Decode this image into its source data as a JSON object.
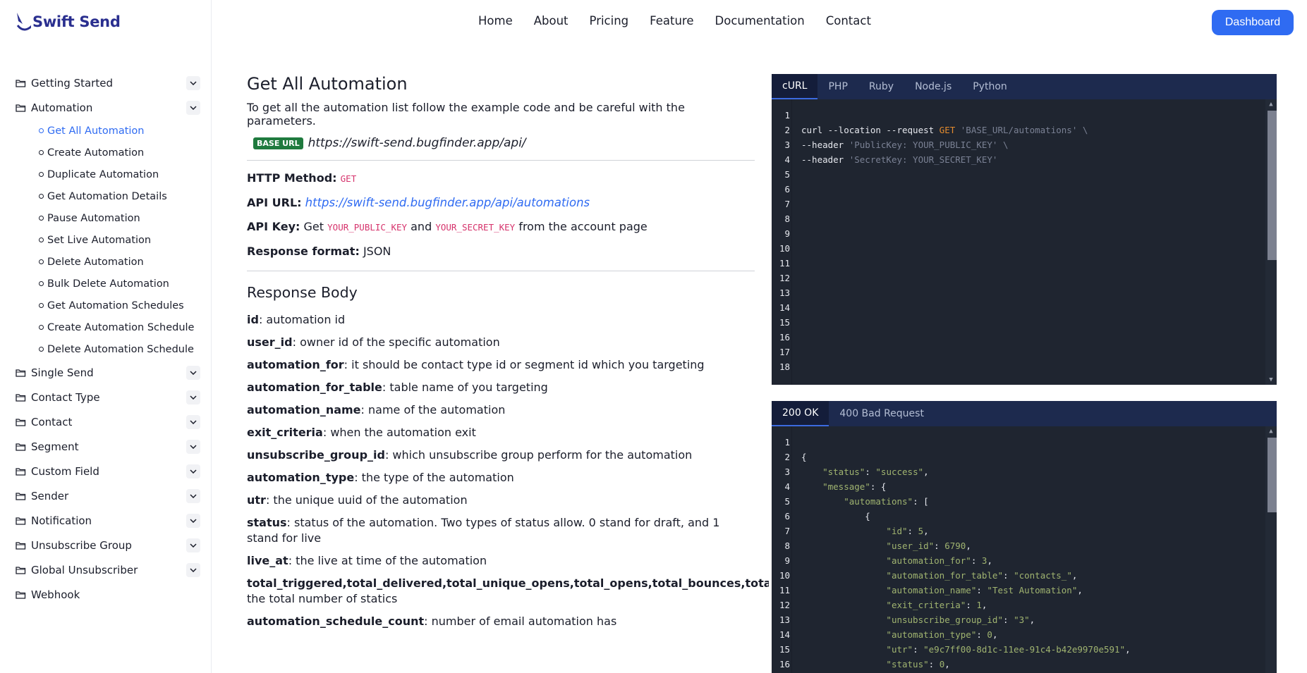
{
  "brand": {
    "name": "Swift Send"
  },
  "topnav": {
    "links": [
      "Home",
      "About",
      "Pricing",
      "Feature",
      "Documentation",
      "Contact"
    ],
    "dashboard": "Dashboard"
  },
  "sidebar": {
    "sections": [
      {
        "label": "Getting Started",
        "expandable": true
      },
      {
        "label": "Automation",
        "expandable": true,
        "expanded": true,
        "items": [
          {
            "label": "Get All Automation",
            "active": true
          },
          {
            "label": "Create Automation"
          },
          {
            "label": "Duplicate Automation"
          },
          {
            "label": "Get Automation Details"
          },
          {
            "label": "Pause Automation"
          },
          {
            "label": "Set Live Automation"
          },
          {
            "label": "Delete Automation"
          },
          {
            "label": "Bulk Delete Automation"
          },
          {
            "label": "Get Automation Schedules"
          },
          {
            "label": "Create Automation Schedule"
          },
          {
            "label": "Delete Automation Schedule"
          }
        ]
      },
      {
        "label": "Single Send",
        "expandable": true
      },
      {
        "label": "Contact Type",
        "expandable": true
      },
      {
        "label": "Contact",
        "expandable": true
      },
      {
        "label": "Segment",
        "expandable": true
      },
      {
        "label": "Custom Field",
        "expandable": true
      },
      {
        "label": "Sender",
        "expandable": true
      },
      {
        "label": "Notification",
        "expandable": true
      },
      {
        "label": "Unsubscribe Group",
        "expandable": true
      },
      {
        "label": "Global Unsubscriber",
        "expandable": true
      },
      {
        "label": "Webhook",
        "expandable": false
      }
    ]
  },
  "main": {
    "title": "Get All Automation",
    "intro": "To get all the automation list follow the example code and be careful with the parameters.",
    "base_badge": "BASE URL",
    "base_url": "https://swift-send.bugfinder.app/api/",
    "http_method_label": "HTTP Method:",
    "http_method": "GET",
    "api_url_label": "API URL:",
    "api_url": "https://swift-send.bugfinder.app/api/automations",
    "api_key_label": "API Key:",
    "api_key_get": "Get",
    "public_key": "YOUR_PUBLIC_KEY",
    "api_key_and": "and",
    "secret_key": "YOUR_SECRET_KEY",
    "api_key_tail": "from the account page",
    "response_format_label": "Response format:",
    "response_format": "JSON",
    "response_title": "Response Body",
    "fields": [
      {
        "name": "id",
        "desc": ": automation id"
      },
      {
        "name": "user_id",
        "desc": ": owner id of the specific automation"
      },
      {
        "name": "automation_for",
        "desc": ": it should be contact type id or segment id which you targeting"
      },
      {
        "name": "automation_for_table",
        "desc": ": table name of you targeting"
      },
      {
        "name": "automation_name",
        "desc": ": name of the automation"
      },
      {
        "name": "exit_criteria",
        "desc": ": when the automation exit"
      },
      {
        "name": "unsubscribe_group_id",
        "desc": ": which unsubscribe group perform for the automation"
      },
      {
        "name": "automation_type",
        "desc": ": the type of the automation"
      },
      {
        "name": "utr",
        "desc": ": the unique uuid of the automation"
      },
      {
        "name": "status",
        "desc": ": status of the automation. Two types of status allow. 0 stand for draft, and 1 stand for live"
      },
      {
        "name": "live_at",
        "desc": ": the live at time of the automation"
      },
      {
        "name": "total_triggered,total_delivered,total_unique_opens,total_opens,total_bounces,total_unsubscrib",
        "desc": "",
        "desc_line2": "the total number of statics"
      },
      {
        "name": "automation_schedule_count",
        "desc": ": number of email automation has"
      }
    ]
  },
  "request_panel": {
    "tabs": [
      "cURL",
      "PHP",
      "Ruby",
      "Node.js",
      "Python"
    ],
    "active_tab": "cURL",
    "line_numbers": [
      "1",
      "2",
      "3",
      "4",
      "5",
      "6",
      "7",
      "8",
      "9",
      "10",
      "11",
      "12",
      "13",
      "14",
      "15",
      "16",
      "17",
      "18"
    ],
    "code": {
      "l2a": "curl --location --request ",
      "l2b": "GET",
      "l2c": " 'BASE_URL/automations' \\",
      "l3a": "--header ",
      "l3b": "'PublicKey: YOUR_PUBLIC_KEY' \\",
      "l4a": "--header ",
      "l4b": "'SecretKey: YOUR_SECRET_KEY'"
    }
  },
  "response_panel": {
    "tabs": [
      "200 OK",
      "400 Bad Request"
    ],
    "active_tab": "200 OK",
    "line_numbers": [
      "1",
      "2",
      "3",
      "4",
      "5",
      "6",
      "7",
      "8",
      "9",
      "10",
      "11",
      "12",
      "13",
      "14",
      "15",
      "16"
    ],
    "json_lines": [
      "",
      "{",
      "    \"status\": \"success\",",
      "    \"message\": {",
      "        \"automations\": [",
      "            {",
      "                \"id\": 5,",
      "                \"user_id\": 6790,",
      "                \"automation_for\": 3,",
      "                \"automation_for_table\": \"contacts_\",",
      "                \"automation_name\": \"Test Automation\",",
      "                \"exit_criteria\": 1,",
      "                \"unsubscribe_group_id\": \"3\",",
      "                \"automation_type\": 0,",
      "                \"utr\": \"e9c7ff00-8d1c-11ee-91c4-b42e9970e591\",",
      "                \"status\": 0,"
    ]
  },
  "colors": {
    "accent": "#2f6bf2",
    "badge": "#1f7a3e",
    "code_bg": "#1f2530",
    "tab_bg": "#1d2a4e",
    "keyword": "#e38b2e",
    "string": "#a0b470"
  }
}
